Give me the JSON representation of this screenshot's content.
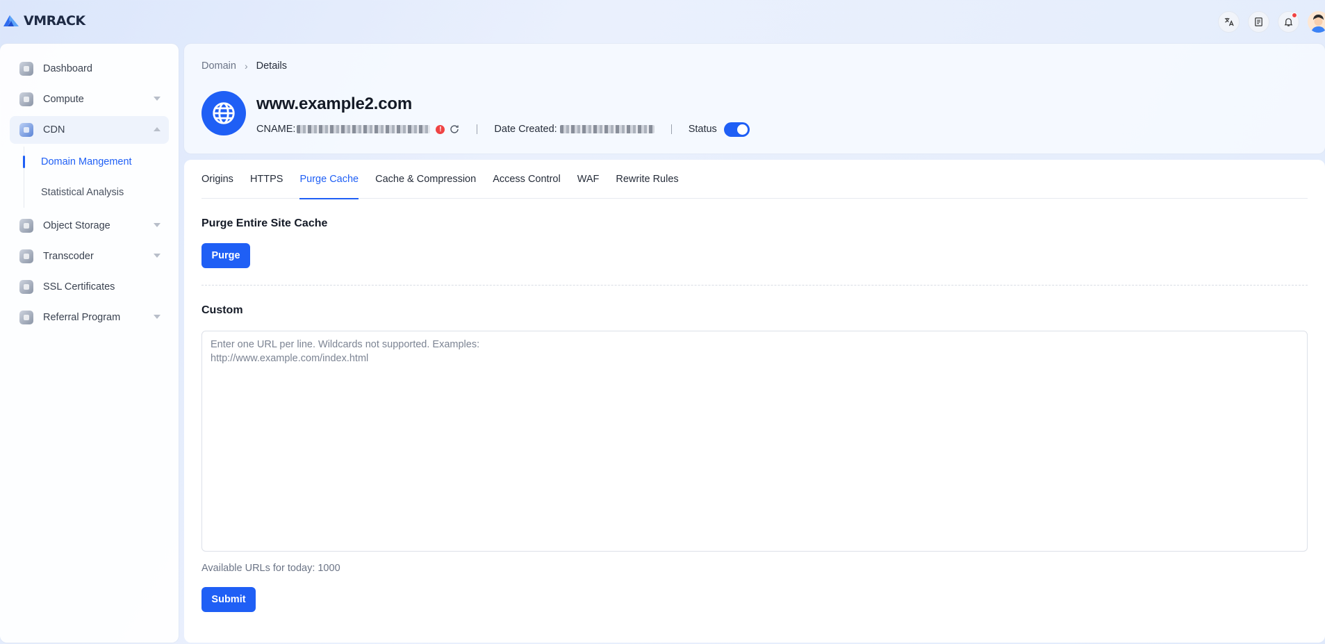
{
  "brand": {
    "name": "VMRACK"
  },
  "topbar": {
    "icons": [
      "translate-icon",
      "document-icon",
      "bell-icon"
    ],
    "has_notification": true
  },
  "sidebar": {
    "items": [
      {
        "label": "Dashboard",
        "icon": "dashboard-icon",
        "expandable": false
      },
      {
        "label": "Compute",
        "icon": "compute-icon",
        "expandable": true
      },
      {
        "label": "CDN",
        "icon": "cdn-icon",
        "expandable": true,
        "expanded": true,
        "active": true
      },
      {
        "label": "Object Storage",
        "icon": "storage-icon",
        "expandable": true
      },
      {
        "label": "Transcoder",
        "icon": "transcoder-icon",
        "expandable": true
      },
      {
        "label": "SSL Certificates",
        "icon": "shield-icon",
        "expandable": false
      },
      {
        "label": "Referral Program",
        "icon": "referral-icon",
        "expandable": true
      }
    ],
    "cdn_subitems": [
      {
        "label": "Domain Mangement",
        "active": true
      },
      {
        "label": "Statistical Analysis",
        "active": false
      }
    ]
  },
  "header": {
    "breadcrumb": [
      "Domain",
      "Details"
    ],
    "domain": "www.example2.com",
    "cname_label": "CNAME:",
    "date_created_label": "Date Created:",
    "status_label": "Status",
    "status_on": true
  },
  "tabs": [
    {
      "label": "Origins",
      "active": false
    },
    {
      "label": "HTTPS",
      "active": false
    },
    {
      "label": "Purge Cache",
      "active": true
    },
    {
      "label": "Cache & Compression",
      "active": false
    },
    {
      "label": "Access Control",
      "active": false
    },
    {
      "label": "WAF",
      "active": false
    },
    {
      "label": "Rewrite Rules",
      "active": false
    }
  ],
  "purge": {
    "section_title": "Purge Entire Site Cache",
    "button_label": "Purge"
  },
  "custom": {
    "section_title": "Custom",
    "placeholder": "Enter one URL per line. Wildcards not supported. Examples:\nhttp://www.example.com/index.html",
    "available_text": "Available URLs for today: 1000",
    "submit_label": "Submit"
  },
  "colors": {
    "accent": "#1f5ff5",
    "alert": "#ef4444"
  }
}
